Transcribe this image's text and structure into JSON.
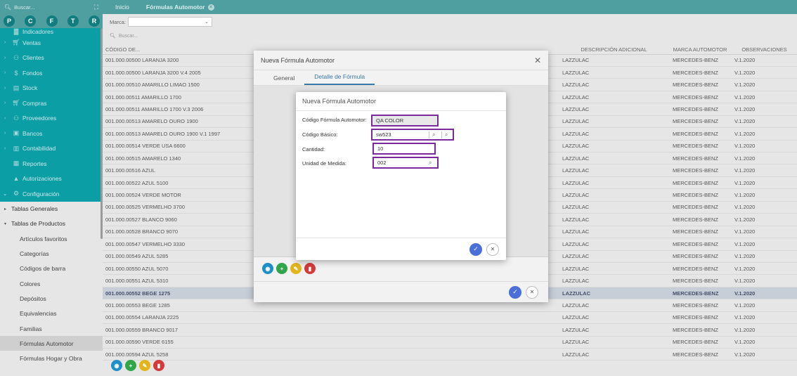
{
  "sidebar": {
    "search_placeholder": "Buscar...",
    "avatars": [
      "P",
      "C",
      "F",
      "T",
      "R"
    ],
    "partial_item": "Indicadores",
    "menu": [
      {
        "label": "Ventas",
        "icon": "cart-icon"
      },
      {
        "label": "Clientes",
        "icon": "users-icon"
      },
      {
        "label": "Fondos",
        "icon": "dollar-icon"
      },
      {
        "label": "Stock",
        "icon": "box-icon"
      },
      {
        "label": "Compras",
        "icon": "cart-icon"
      },
      {
        "label": "Proveedores",
        "icon": "users-icon"
      },
      {
        "label": "Bancos",
        "icon": "briefcase-icon"
      },
      {
        "label": "Contabilidad",
        "icon": "ledger-icon"
      },
      {
        "label": "Reportes",
        "icon": "report-icon"
      },
      {
        "label": "Autorizaciones",
        "icon": "lock-icon"
      },
      {
        "label": "Configuración",
        "icon": "gears-icon"
      }
    ],
    "submenu": {
      "tablas_generales": "Tablas Generales",
      "tablas_productos": "Tablas de Productos",
      "items": [
        "Artículos favoritos",
        "Categorías",
        "Códigos de barra",
        "Colores",
        "Depósitos",
        "Equivalencias",
        "Familias",
        "Fórmulas Automotor",
        "Fórmulas Hogar y Obra"
      ]
    }
  },
  "tabs": {
    "inicio": "Inicio",
    "formulas": "Fórmulas Automotor"
  },
  "main": {
    "marca_label": "Marca:",
    "search_placeholder": "Buscar...",
    "columns": {
      "codigo": "CÓDIGO DE...",
      "descripcion_adicional": "DESCRIPCIÓN ADICIONAL",
      "marca_automotor": "MARCA AUTOMOTOR",
      "observaciones": "OBSERVACIONES"
    },
    "rows": [
      [
        "001.000.00500 LARANJA 3200",
        "LAZZULAC",
        "MERCEDES-BENZ",
        "V.1.2020"
      ],
      [
        "001.000.00500 LARANJA 3200 V.4 2005",
        "LAZZULAC",
        "MERCEDES-BENZ",
        "V.1.2020"
      ],
      [
        "001.000.00510 AMARILLO LIMAO 1500",
        "LAZZULAC",
        "MERCEDES-BENZ",
        "V.1.2020"
      ],
      [
        "001.000.00511 AMARILLO 1700",
        "LAZZULAC",
        "MERCEDES-BENZ",
        "V.1.2020"
      ],
      [
        "001.000.00511 AMARILLO 1700 V.3 2006",
        "LAZZULAC",
        "MERCEDES-BENZ",
        "V.1.2020"
      ],
      [
        "001.000.00513 AMARELO OURO 1900",
        "LAZZULAC",
        "MERCEDES-BENZ",
        "V.1.2020"
      ],
      [
        "001.000.00513 AMARELO OURO 1900 V.1 1997",
        "LAZZULAC",
        "MERCEDES-BENZ",
        "V.1.2020"
      ],
      [
        "001.000.00514 VERDE USA 6600",
        "LAZZULAC",
        "MERCEDES-BENZ",
        "V.1.2020"
      ],
      [
        "001.000.00515 AMARELO 1340",
        "LAZZULAC",
        "MERCEDES-BENZ",
        "V.1.2020"
      ],
      [
        "001.000.00516 AZUL",
        "LAZZULAC",
        "MERCEDES-BENZ",
        "V.1.2020"
      ],
      [
        "001.000.00522 AZUL 5100",
        "LAZZULAC",
        "MERCEDES-BENZ",
        "V.1.2020"
      ],
      [
        "001.000.00524 VERDE MOTOR",
        "LAZZULAC",
        "MERCEDES-BENZ",
        "V.1.2020"
      ],
      [
        "001.000.00525 VERMELHO 3700",
        "LAZZULAC",
        "MERCEDES-BENZ",
        "V.1.2020"
      ],
      [
        "001.000.00527 BLANCO 9060",
        "LAZZULAC",
        "MERCEDES-BENZ",
        "V.1.2020"
      ],
      [
        "001.000.00528 BRANCO 9070",
        "LAZZULAC",
        "MERCEDES-BENZ",
        "V.1.2020"
      ],
      [
        "001.000.00547 VERMELHO 3330",
        "LAZZULAC",
        "MERCEDES-BENZ",
        "V.1.2020"
      ],
      [
        "001.000.00549 AZUL 5285",
        "LAZZULAC",
        "MERCEDES-BENZ",
        "V.1.2020"
      ],
      [
        "001.000.00550 AZUL 5070",
        "LAZZULAC",
        "MERCEDES-BENZ",
        "V.1.2020"
      ],
      [
        "001.000.00551 AZUL 5310",
        "LAZZULAC",
        "MERCEDES-BENZ",
        "V.1.2020"
      ],
      [
        "001.000.00552 BEGE 1275",
        "LAZZULAC",
        "MERCEDES-BENZ",
        "V.1.2020"
      ],
      [
        "001.000.00553 BEGE 1285",
        "LAZZULAC",
        "MERCEDES-BENZ",
        "V.1.2020"
      ],
      [
        "001.000.00554 LARANJA 2225",
        "LAZZULAC",
        "MERCEDES-BENZ",
        "V.1.2020"
      ],
      [
        "001.000.00559 BRANCO 9017",
        "LAZZULAC",
        "MERCEDES-BENZ",
        "V.1.2020"
      ],
      [
        "001.000.00590 VERDE 6155",
        "LAZZULAC",
        "MERCEDES-BENZ",
        "V.1.2020"
      ],
      [
        "001.000.00594 AZUL 5258",
        "LAZZULAC",
        "MERCEDES-BENZ",
        "V.1.2020"
      ]
    ],
    "highlighted_row_index": 19
  },
  "modal_outer": {
    "title": "Nueva Fórmula Automotor",
    "tab_general": "General",
    "tab_detalle": "Detalle de Fórmula"
  },
  "modal_inner": {
    "title": "Nueva Fórmula Automotor",
    "codigo_formula_label": "Código Fórmula Automotor:",
    "codigo_formula_value": "QA COLOR",
    "codigo_basico_label": "Código Básico:",
    "codigo_basico_value": "sw523",
    "cantidad_label": "Cantidad:",
    "cantidad_value": "10",
    "unidad_label": "Unidad de Medida:",
    "unidad_value": "002"
  },
  "colors": {
    "teal_header": "#4f9ea0",
    "teal_menu": "#0b9ea5",
    "highlight_box": "#7b2a9e",
    "confirm_blue": "#4b6fd8",
    "selected_row": "#c7ced8"
  }
}
